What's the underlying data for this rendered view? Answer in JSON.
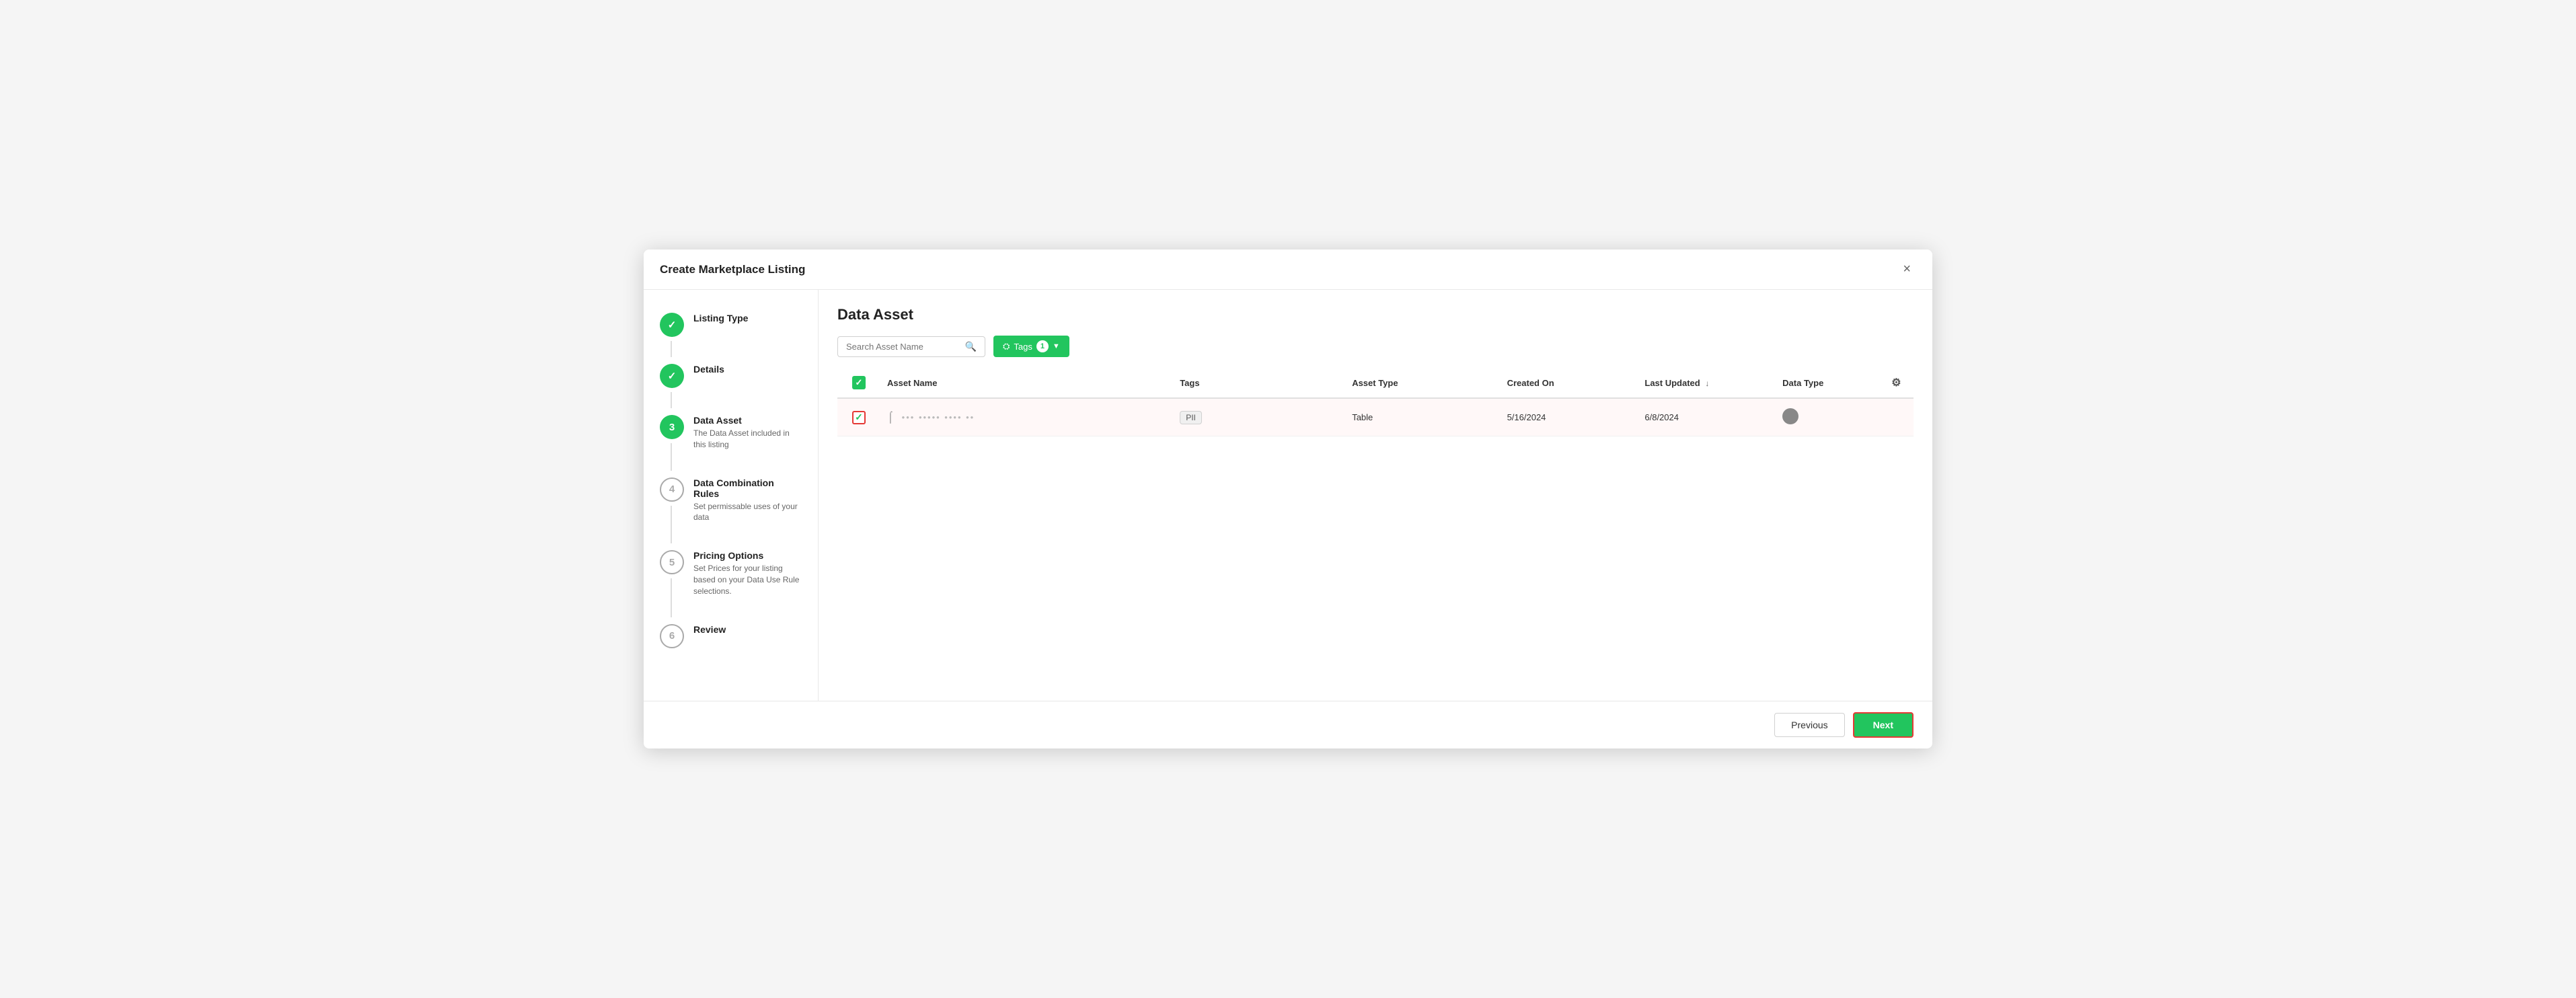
{
  "modal": {
    "title": "Create Marketplace Listing",
    "close_label": "×"
  },
  "sidebar": {
    "steps": [
      {
        "id": "listing-type",
        "number": "✓",
        "label": "Listing Type",
        "description": "",
        "state": "completed"
      },
      {
        "id": "details",
        "number": "✓",
        "label": "Details",
        "description": "",
        "state": "completed"
      },
      {
        "id": "data-asset",
        "number": "3",
        "label": "Data Asset",
        "description": "The Data Asset included in this listing",
        "state": "active"
      },
      {
        "id": "data-combination-rules",
        "number": "4",
        "label": "Data Combination Rules",
        "description": "Set permissable uses of your data",
        "state": "inactive"
      },
      {
        "id": "pricing-options",
        "number": "5",
        "label": "Pricing Options",
        "description": "Set Prices for your listing based on your Data Use Rule selections.",
        "state": "inactive"
      },
      {
        "id": "review",
        "number": "6",
        "label": "Review",
        "description": "",
        "state": "inactive"
      }
    ]
  },
  "content": {
    "title": "Data Asset",
    "search_placeholder": "Search Asset Name",
    "tags_button_label": "Tags",
    "tags_badge_count": "1",
    "table": {
      "columns": [
        {
          "id": "checkbox",
          "label": ""
        },
        {
          "id": "asset-name",
          "label": "Asset Name"
        },
        {
          "id": "tags",
          "label": "Tags"
        },
        {
          "id": "asset-type",
          "label": "Asset Type"
        },
        {
          "id": "created-on",
          "label": "Created On"
        },
        {
          "id": "last-updated",
          "label": "Last Updated"
        },
        {
          "id": "data-type",
          "label": "Data Type"
        },
        {
          "id": "settings",
          "label": ""
        }
      ],
      "rows": [
        {
          "id": "row-1",
          "selected": true,
          "asset_name_placeholder": "••••••••••••",
          "tags": [
            "PII"
          ],
          "asset_type": "Table",
          "created_on": "5/16/2024",
          "last_updated": "6/8/2024",
          "data_type": "circle"
        }
      ]
    }
  },
  "footer": {
    "previous_label": "Previous",
    "next_label": "Next"
  }
}
